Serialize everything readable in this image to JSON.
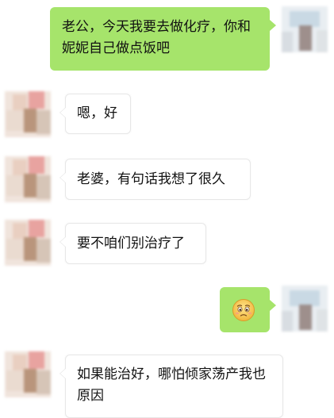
{
  "colors": {
    "outgoing_bubble": "#a6e46b",
    "incoming_bubble": "#ffffff",
    "background": "#ffffff"
  },
  "messages": [
    {
      "side": "right",
      "type": "text",
      "text": "老公，今天我要去做化疗，你和妮妮自己做点饭吧"
    },
    {
      "side": "left",
      "type": "text",
      "text": "嗯，好"
    },
    {
      "side": "left",
      "type": "text",
      "text": "老婆，有句话我想了很久"
    },
    {
      "side": "left",
      "type": "text",
      "text": "要不咱们别治疗了"
    },
    {
      "side": "right",
      "type": "emoji",
      "icon": "worried-face-icon"
    },
    {
      "side": "left",
      "type": "text",
      "text": "如果能治好，哪怕倾家荡产我也原因"
    }
  ]
}
